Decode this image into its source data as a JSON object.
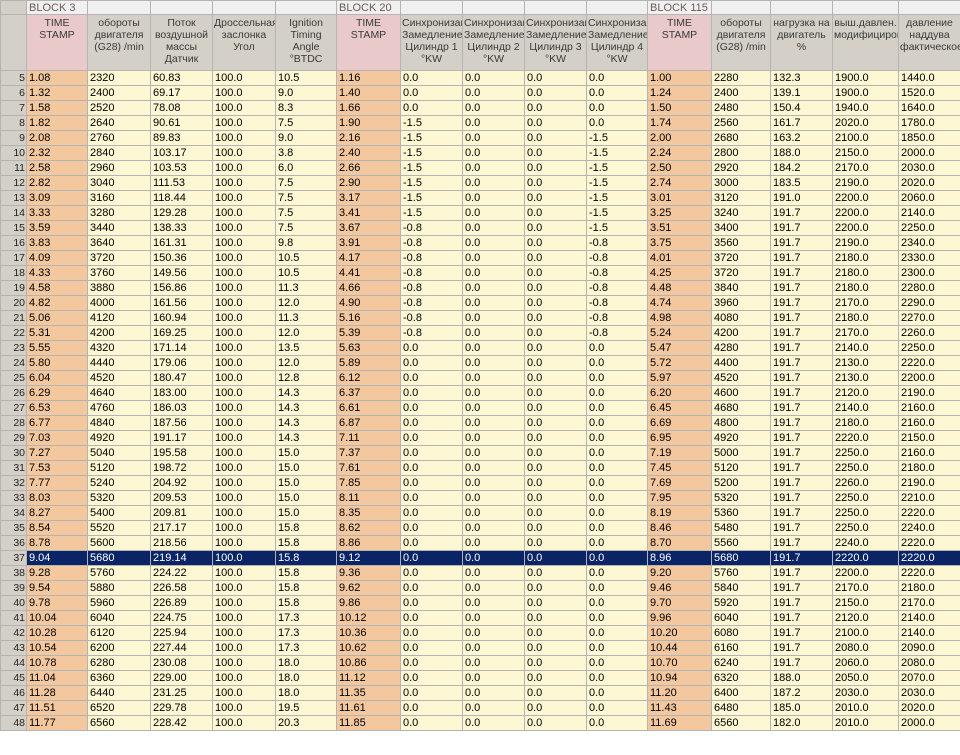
{
  "blocks": [
    "BLOCK 3",
    "BLOCK 20",
    "BLOCK 115"
  ],
  "headers": [
    "TIME STAMP",
    "обороты двигателя (G28) /min",
    "Поток воздушной массы Датчик",
    "Дроссельная заслонка Угол",
    "Ignition Timing Angle °BTDC",
    "TIME STAMP",
    "Синхронизация Замедление Цилиндр 1 °KW",
    "Синхронизация Замедление Цилиндр 2 °KW",
    "Синхронизация Замедление Цилиндр 3 °KW",
    "Синхронизация Замедление Цилиндр 4 °KW",
    "TIME STAMP",
    "обороты двигателя (G28) /min",
    "нагрузка на двигатель %",
    "выш.давлен. модифицированное",
    "давление наддува фактическое"
  ],
  "selected_row": "37",
  "rows": [
    [
      "5",
      "1.08",
      "2320",
      "60.83",
      "100.0",
      "10.5",
      "1.16",
      "0.0",
      "0.0",
      "0.0",
      "0.0",
      "1.00",
      "2280",
      "132.3",
      "1900.0",
      "1440.0"
    ],
    [
      "6",
      "1.32",
      "2400",
      "69.17",
      "100.0",
      "9.0",
      "1.40",
      "0.0",
      "0.0",
      "0.0",
      "0.0",
      "1.24",
      "2400",
      "139.1",
      "1900.0",
      "1520.0"
    ],
    [
      "7",
      "1.58",
      "2520",
      "78.08",
      "100.0",
      "8.3",
      "1.66",
      "0.0",
      "0.0",
      "0.0",
      "0.0",
      "1.50",
      "2480",
      "150.4",
      "1940.0",
      "1640.0"
    ],
    [
      "8",
      "1.82",
      "2640",
      "90.61",
      "100.0",
      "7.5",
      "1.90",
      "-1.5",
      "0.0",
      "0.0",
      "0.0",
      "1.74",
      "2560",
      "161.7",
      "2020.0",
      "1780.0"
    ],
    [
      "9",
      "2.08",
      "2760",
      "89.83",
      "100.0",
      "9.0",
      "2.16",
      "-1.5",
      "0.0",
      "0.0",
      "-1.5",
      "2.00",
      "2680",
      "163.2",
      "2100.0",
      "1850.0"
    ],
    [
      "10",
      "2.32",
      "2840",
      "103.17",
      "100.0",
      "3.8",
      "2.40",
      "-1.5",
      "0.0",
      "0.0",
      "-1.5",
      "2.24",
      "2800",
      "188.0",
      "2150.0",
      "2000.0"
    ],
    [
      "11",
      "2.58",
      "2960",
      "103.53",
      "100.0",
      "6.0",
      "2.66",
      "-1.5",
      "0.0",
      "0.0",
      "-1.5",
      "2.50",
      "2920",
      "184.2",
      "2170.0",
      "2030.0"
    ],
    [
      "12",
      "2.82",
      "3040",
      "111.53",
      "100.0",
      "7.5",
      "2.90",
      "-1.5",
      "0.0",
      "0.0",
      "-1.5",
      "2.74",
      "3000",
      "183.5",
      "2190.0",
      "2020.0"
    ],
    [
      "13",
      "3.09",
      "3160",
      "118.44",
      "100.0",
      "7.5",
      "3.17",
      "-1.5",
      "0.0",
      "0.0",
      "-1.5",
      "3.01",
      "3120",
      "191.0",
      "2200.0",
      "2060.0"
    ],
    [
      "14",
      "3.33",
      "3280",
      "129.28",
      "100.0",
      "7.5",
      "3.41",
      "-1.5",
      "0.0",
      "0.0",
      "-1.5",
      "3.25",
      "3240",
      "191.7",
      "2200.0",
      "2140.0"
    ],
    [
      "15",
      "3.59",
      "3440",
      "138.33",
      "100.0",
      "7.5",
      "3.67",
      "-0.8",
      "0.0",
      "0.0",
      "-1.5",
      "3.51",
      "3400",
      "191.7",
      "2200.0",
      "2250.0"
    ],
    [
      "16",
      "3.83",
      "3640",
      "161.31",
      "100.0",
      "9.8",
      "3.91",
      "-0.8",
      "0.0",
      "0.0",
      "-0.8",
      "3.75",
      "3560",
      "191.7",
      "2190.0",
      "2340.0"
    ],
    [
      "17",
      "4.09",
      "3720",
      "150.36",
      "100.0",
      "10.5",
      "4.17",
      "-0.8",
      "0.0",
      "0.0",
      "-0.8",
      "4.01",
      "3720",
      "191.7",
      "2180.0",
      "2330.0"
    ],
    [
      "18",
      "4.33",
      "3760",
      "149.56",
      "100.0",
      "10.5",
      "4.41",
      "-0.8",
      "0.0",
      "0.0",
      "-0.8",
      "4.25",
      "3720",
      "191.7",
      "2180.0",
      "2300.0"
    ],
    [
      "19",
      "4.58",
      "3880",
      "156.86",
      "100.0",
      "11.3",
      "4.66",
      "-0.8",
      "0.0",
      "0.0",
      "-0.8",
      "4.48",
      "3840",
      "191.7",
      "2180.0",
      "2280.0"
    ],
    [
      "20",
      "4.82",
      "4000",
      "161.56",
      "100.0",
      "12.0",
      "4.90",
      "-0.8",
      "0.0",
      "0.0",
      "-0.8",
      "4.74",
      "3960",
      "191.7",
      "2170.0",
      "2290.0"
    ],
    [
      "21",
      "5.06",
      "4120",
      "160.94",
      "100.0",
      "11.3",
      "5.16",
      "-0.8",
      "0.0",
      "0.0",
      "-0.8",
      "4.98",
      "4080",
      "191.7",
      "2180.0",
      "2270.0"
    ],
    [
      "22",
      "5.31",
      "4200",
      "169.25",
      "100.0",
      "12.0",
      "5.39",
      "-0.8",
      "0.0",
      "0.0",
      "-0.8",
      "5.24",
      "4200",
      "191.7",
      "2170.0",
      "2260.0"
    ],
    [
      "23",
      "5.55",
      "4320",
      "171.14",
      "100.0",
      "13.5",
      "5.63",
      "0.0",
      "0.0",
      "0.0",
      "0.0",
      "5.47",
      "4280",
      "191.7",
      "2140.0",
      "2250.0"
    ],
    [
      "24",
      "5.80",
      "4440",
      "179.06",
      "100.0",
      "12.0",
      "5.89",
      "0.0",
      "0.0",
      "0.0",
      "0.0",
      "5.72",
      "4400",
      "191.7",
      "2130.0",
      "2220.0"
    ],
    [
      "25",
      "6.04",
      "4520",
      "180.47",
      "100.0",
      "12.8",
      "6.12",
      "0.0",
      "0.0",
      "0.0",
      "0.0",
      "5.97",
      "4520",
      "191.7",
      "2130.0",
      "2200.0"
    ],
    [
      "26",
      "6.29",
      "4640",
      "183.00",
      "100.0",
      "14.3",
      "6.37",
      "0.0",
      "0.0",
      "0.0",
      "0.0",
      "6.20",
      "4600",
      "191.7",
      "2120.0",
      "2190.0"
    ],
    [
      "27",
      "6.53",
      "4760",
      "186.03",
      "100.0",
      "14.3",
      "6.61",
      "0.0",
      "0.0",
      "0.0",
      "0.0",
      "6.45",
      "4680",
      "191.7",
      "2140.0",
      "2160.0"
    ],
    [
      "28",
      "6.77",
      "4840",
      "187.56",
      "100.0",
      "14.3",
      "6.87",
      "0.0",
      "0.0",
      "0.0",
      "0.0",
      "6.69",
      "4800",
      "191.7",
      "2180.0",
      "2160.0"
    ],
    [
      "29",
      "7.03",
      "4920",
      "191.17",
      "100.0",
      "14.3",
      "7.11",
      "0.0",
      "0.0",
      "0.0",
      "0.0",
      "6.95",
      "4920",
      "191.7",
      "2220.0",
      "2150.0"
    ],
    [
      "30",
      "7.27",
      "5040",
      "195.58",
      "100.0",
      "15.0",
      "7.37",
      "0.0",
      "0.0",
      "0.0",
      "0.0",
      "7.19",
      "5000",
      "191.7",
      "2250.0",
      "2160.0"
    ],
    [
      "31",
      "7.53",
      "5120",
      "198.72",
      "100.0",
      "15.0",
      "7.61",
      "0.0",
      "0.0",
      "0.0",
      "0.0",
      "7.45",
      "5120",
      "191.7",
      "2250.0",
      "2180.0"
    ],
    [
      "32",
      "7.77",
      "5240",
      "204.92",
      "100.0",
      "15.0",
      "7.85",
      "0.0",
      "0.0",
      "0.0",
      "0.0",
      "7.69",
      "5200",
      "191.7",
      "2260.0",
      "2190.0"
    ],
    [
      "33",
      "8.03",
      "5320",
      "209.53",
      "100.0",
      "15.0",
      "8.11",
      "0.0",
      "0.0",
      "0.0",
      "0.0",
      "7.95",
      "5320",
      "191.7",
      "2250.0",
      "2210.0"
    ],
    [
      "34",
      "8.27",
      "5400",
      "209.81",
      "100.0",
      "15.0",
      "8.35",
      "0.0",
      "0.0",
      "0.0",
      "0.0",
      "8.19",
      "5360",
      "191.7",
      "2250.0",
      "2220.0"
    ],
    [
      "35",
      "8.54",
      "5520",
      "217.17",
      "100.0",
      "15.8",
      "8.62",
      "0.0",
      "0.0",
      "0.0",
      "0.0",
      "8.46",
      "5480",
      "191.7",
      "2250.0",
      "2240.0"
    ],
    [
      "36",
      "8.78",
      "5600",
      "218.56",
      "100.0",
      "15.8",
      "8.86",
      "0.0",
      "0.0",
      "0.0",
      "0.0",
      "8.70",
      "5560",
      "191.7",
      "2240.0",
      "2220.0"
    ],
    [
      "37",
      "9.04",
      "5680",
      "219.14",
      "100.0",
      "15.8",
      "9.12",
      "0.0",
      "0.0",
      "0.0",
      "0.0",
      "8.96",
      "5680",
      "191.7",
      "2220.0",
      "2220.0"
    ],
    [
      "38",
      "9.28",
      "5760",
      "224.22",
      "100.0",
      "15.8",
      "9.36",
      "0.0",
      "0.0",
      "0.0",
      "0.0",
      "9.20",
      "5760",
      "191.7",
      "2200.0",
      "2220.0"
    ],
    [
      "39",
      "9.54",
      "5880",
      "226.58",
      "100.0",
      "15.8",
      "9.62",
      "0.0",
      "0.0",
      "0.0",
      "0.0",
      "9.46",
      "5840",
      "191.7",
      "2170.0",
      "2180.0"
    ],
    [
      "40",
      "9.78",
      "5960",
      "226.89",
      "100.0",
      "15.8",
      "9.86",
      "0.0",
      "0.0",
      "0.0",
      "0.0",
      "9.70",
      "5920",
      "191.7",
      "2150.0",
      "2170.0"
    ],
    [
      "41",
      "10.04",
      "6040",
      "224.75",
      "100.0",
      "17.3",
      "10.12",
      "0.0",
      "0.0",
      "0.0",
      "0.0",
      "9.96",
      "6040",
      "191.7",
      "2120.0",
      "2140.0"
    ],
    [
      "42",
      "10.28",
      "6120",
      "225.94",
      "100.0",
      "17.3",
      "10.36",
      "0.0",
      "0.0",
      "0.0",
      "0.0",
      "10.20",
      "6080",
      "191.7",
      "2100.0",
      "2140.0"
    ],
    [
      "43",
      "10.54",
      "6200",
      "227.44",
      "100.0",
      "17.3",
      "10.62",
      "0.0",
      "0.0",
      "0.0",
      "0.0",
      "10.44",
      "6160",
      "191.7",
      "2080.0",
      "2090.0"
    ],
    [
      "44",
      "10.78",
      "6280",
      "230.08",
      "100.0",
      "18.0",
      "10.86",
      "0.0",
      "0.0",
      "0.0",
      "0.0",
      "10.70",
      "6240",
      "191.7",
      "2060.0",
      "2080.0"
    ],
    [
      "45",
      "11.04",
      "6360",
      "229.00",
      "100.0",
      "18.0",
      "11.12",
      "0.0",
      "0.0",
      "0.0",
      "0.0",
      "10.94",
      "6320",
      "188.0",
      "2050.0",
      "2070.0"
    ],
    [
      "46",
      "11.28",
      "6440",
      "231.25",
      "100.0",
      "18.0",
      "11.35",
      "0.0",
      "0.0",
      "0.0",
      "0.0",
      "11.20",
      "6400",
      "187.2",
      "2030.0",
      "2030.0"
    ],
    [
      "47",
      "11.51",
      "6520",
      "229.78",
      "100.0",
      "19.5",
      "11.61",
      "0.0",
      "0.0",
      "0.0",
      "0.0",
      "11.43",
      "6480",
      "185.0",
      "2010.0",
      "2020.0"
    ],
    [
      "48",
      "11.77",
      "6560",
      "228.42",
      "100.0",
      "20.3",
      "11.85",
      "0.0",
      "0.0",
      "0.0",
      "0.0",
      "11.69",
      "6560",
      "182.0",
      "2010.0",
      "2000.0"
    ]
  ]
}
